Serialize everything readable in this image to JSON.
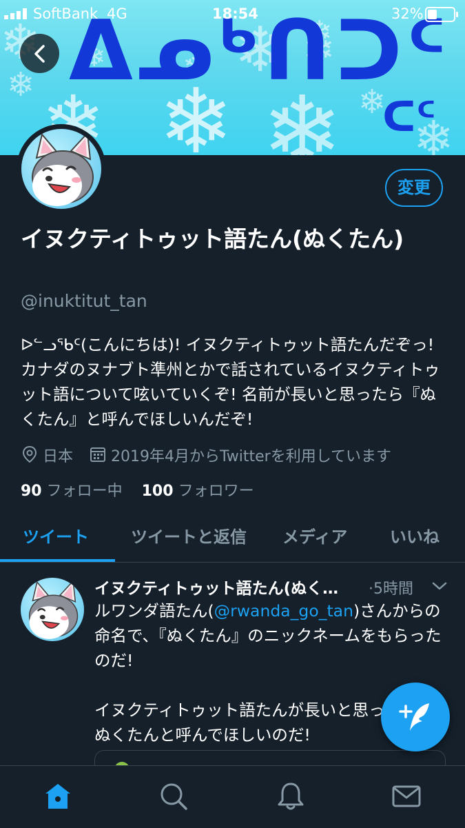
{
  "status_bar": {
    "carrier": "SoftBank",
    "network": "4G",
    "time": "18:54",
    "battery": "32%"
  },
  "banner": {
    "syllabics_main": "ᐃᓄᒃᑎᑐᑦ",
    "syllabics_sub": "ᑕᑦ",
    "background_color": "#5fd8ee",
    "syllabics_color": "#1238d8"
  },
  "header": {
    "back_icon": "chevron-left-icon"
  },
  "profile": {
    "edit_label": "変更",
    "name": "イヌクティトゥット語たん(ぬくたん)",
    "handle": "@inuktitut_tan",
    "bio": "ᐅᓪᓗᖃᑦ(こんにちは)! イヌクティトゥット語たんだぞっ! カナダのヌナブト準州とかで話されているイヌクティトゥット語について呟いていくぞ! 名前が長いと思ったら『ぬくたん』と呼んでほしいんだぞ!",
    "location": "日本",
    "joined": "2019年4月からTwitterを利用しています",
    "following_count": "90",
    "following_label": "フォロー中",
    "followers_count": "100",
    "followers_label": "フォロワー"
  },
  "tabs": [
    {
      "label": "ツイート",
      "active": true
    },
    {
      "label": "ツイートと返信",
      "active": false
    },
    {
      "label": "メディア",
      "active": false
    },
    {
      "label": "いいね",
      "active": false
    }
  ],
  "tweet": {
    "author": "イヌクティトゥット語たん(ぬく…",
    "time": "·5時間",
    "line1_prefix": "ルワンダ語たん(",
    "mention": "@rwanda_go_tan",
    "line1_suffix": ")さんからの命名で、『ぬくたん』のニックネームをもらったのだ!",
    "paragraph2": "イヌクティトゥット語たんが長いと思ったら、ぬくたんと呼んでほしいのだ!"
  },
  "fab": {
    "icon": "compose-tweet-icon"
  },
  "bottom_nav": [
    {
      "icon": "home-icon",
      "active": true
    },
    {
      "icon": "search-icon",
      "active": false
    },
    {
      "icon": "bell-icon",
      "active": false
    },
    {
      "icon": "mail-icon",
      "active": false
    }
  ],
  "colors": {
    "background": "#15202b",
    "accent": "#1da1f2",
    "secondary_text": "#8899a6",
    "divider": "#38444d"
  }
}
